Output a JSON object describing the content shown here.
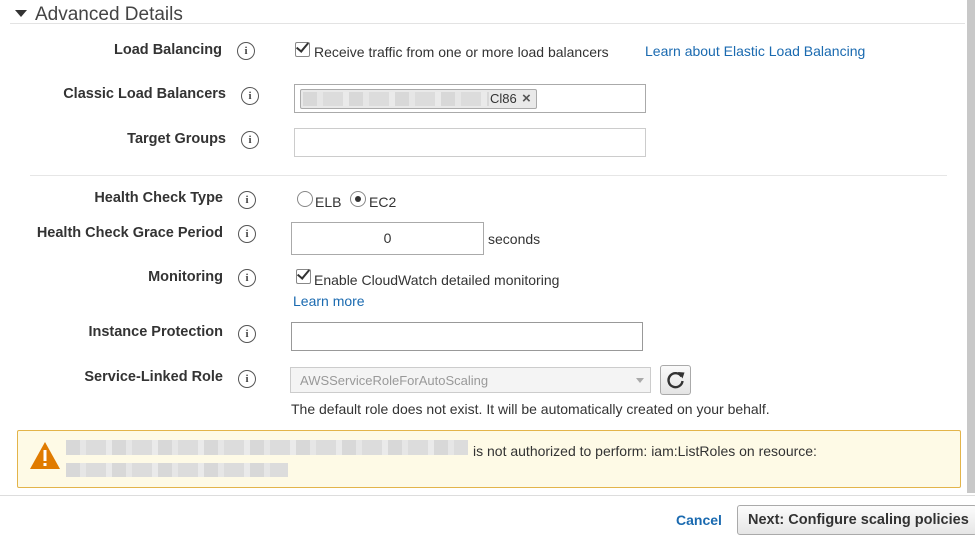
{
  "section": {
    "title": "Advanced Details"
  },
  "fields": {
    "load_balancing": {
      "label": "Load Balancing",
      "checkbox_label": "Receive traffic from one or more load balancers",
      "checked": true,
      "link": "Learn about Elastic Load Balancing"
    },
    "classic_lbs": {
      "label": "Classic Load Balancers",
      "tag_suffix": "Cl86",
      "tag_remove": "×"
    },
    "target_groups": {
      "label": "Target Groups",
      "value": ""
    },
    "health_check_type": {
      "label": "Health Check Type",
      "options": [
        "ELB",
        "EC2"
      ],
      "selected": "EC2"
    },
    "grace_period": {
      "label": "Health Check Grace Period",
      "value": "0",
      "unit": "seconds"
    },
    "monitoring": {
      "label": "Monitoring",
      "checkbox_label": "Enable CloudWatch detailed monitoring",
      "checked": true,
      "link": "Learn more"
    },
    "instance_protection": {
      "label": "Instance Protection",
      "value": ""
    },
    "service_linked_role": {
      "label": "Service-Linked Role",
      "selected": "AWSServiceRoleForAutoScaling",
      "note": "The default role does not exist. It will be automatically created on your behalf."
    }
  },
  "info_icon_glyph": "i",
  "warning": {
    "message": "is not authorized to perform: iam:ListRoles on resource:",
    "icon_glyph": "!",
    "color": "#e07b00"
  },
  "footer": {
    "cancel": "Cancel",
    "next": "Next: Configure scaling policies"
  },
  "colors": {
    "link": "#1a6ab0",
    "warning_border": "#e3b44a",
    "warning_bg": "#fefae6"
  }
}
